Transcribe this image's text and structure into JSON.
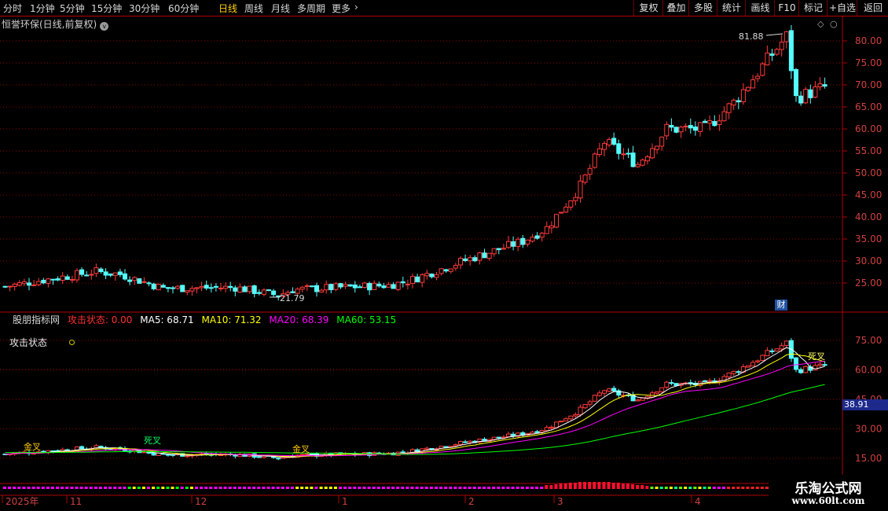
{
  "toolbar": {
    "periods": [
      "分时",
      "1分钟",
      "5分钟",
      "15分钟",
      "30分钟",
      "60分钟",
      "日线",
      "周线",
      "月线",
      "多周期",
      "更多"
    ],
    "active_period": "日线",
    "buttons": [
      "复权",
      "叠加",
      "多股",
      "统计",
      "画线",
      "F10",
      "标记",
      "+自选",
      "返回"
    ]
  },
  "main_title": "恒誉环保(日线,前复权)",
  "price_axis": [
    "80.00",
    "75.00",
    "70.00",
    "65.00",
    "60.00",
    "55.00",
    "50.00",
    "45.00",
    "40.00",
    "35.00",
    "30.00",
    "25.00"
  ],
  "high_label": "81.88",
  "low_label": "21.79",
  "fin_badge": "财",
  "indicator": {
    "name": "股朋指标网",
    "attack_state": "攻击状态: 0.00",
    "ma5": "MA5: 68.71",
    "ma10": "MA10: 71.32",
    "ma20": "MA20: 68.39",
    "ma60": "MA60: 53.15",
    "row_label": "攻击状态",
    "axis": [
      "75.00",
      "60.00",
      "45.00",
      "30.00",
      "15.00"
    ],
    "current_tag": "38.91",
    "annotations": [
      "金叉",
      "死叉",
      "金叉",
      "死叉"
    ]
  },
  "date_axis": [
    "2025年",
    "11",
    "12",
    "1",
    "2",
    "3",
    "4"
  ],
  "watermark": {
    "line1": "乐淘公式网",
    "line2": "www.60lt.com"
  },
  "colors": {
    "up": "#ff3a3a",
    "down": "#54ffff",
    "ma5": "#ffffff",
    "ma10": "#ffff00",
    "ma20": "#ff00ff",
    "ma60": "#00ff00",
    "grid": "#8b0000"
  }
}
